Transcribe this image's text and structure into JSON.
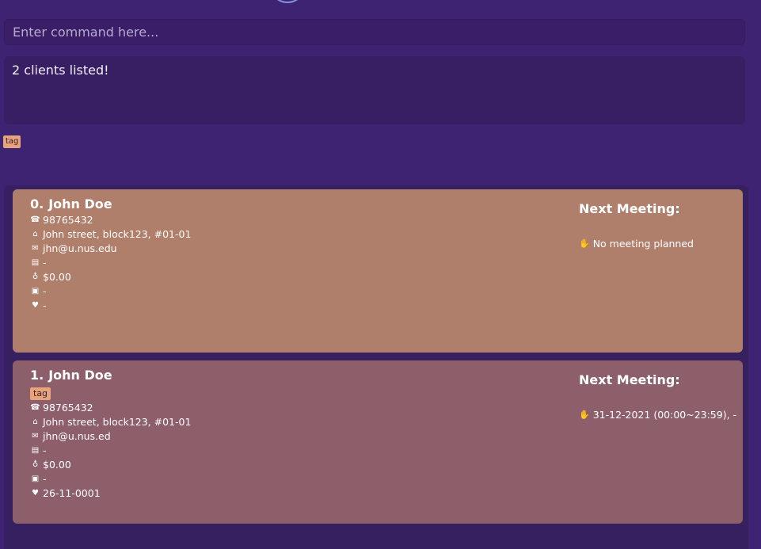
{
  "command": {
    "placeholder": "Enter command here..."
  },
  "result": {
    "message": "2 clients listed!"
  },
  "filter_tags": [
    "tag"
  ],
  "clients": [
    {
      "index": "0.",
      "name": "John Doe",
      "tags": [],
      "phone": "98765432",
      "address": "John street, block123, #01-01",
      "email": "jhn@u.nus.edu",
      "risk": "-",
      "income": "$0.00",
      "insurance": "-",
      "birthday": "-",
      "next_meeting_label": "Next Meeting:",
      "next_meeting": "No meeting planned"
    },
    {
      "index": "1.",
      "name": "John Doe",
      "tags": [
        "tag"
      ],
      "phone": "98765432",
      "address": "John street, block123, #01-01",
      "email": "jhn@u.nus.ed",
      "risk": "-",
      "income": "$0.00",
      "insurance": "-",
      "birthday": "26-11-0001",
      "next_meeting_label": "Next Meeting:",
      "next_meeting": "31-12-2021 (00:00~23:59), -"
    }
  ],
  "icons": {
    "phone": "phone-icon",
    "address": "home-icon",
    "email": "email-icon",
    "risk": "chart-icon",
    "income": "money-bag-icon",
    "insurance": "bank-icon",
    "birthday": "heart-icon",
    "meeting": "wave-icon"
  },
  "colors": {
    "background": "#3f2373",
    "card_0": "#b07f6c",
    "card_1": "#8c5f6a",
    "tag": "#e6a37c"
  }
}
